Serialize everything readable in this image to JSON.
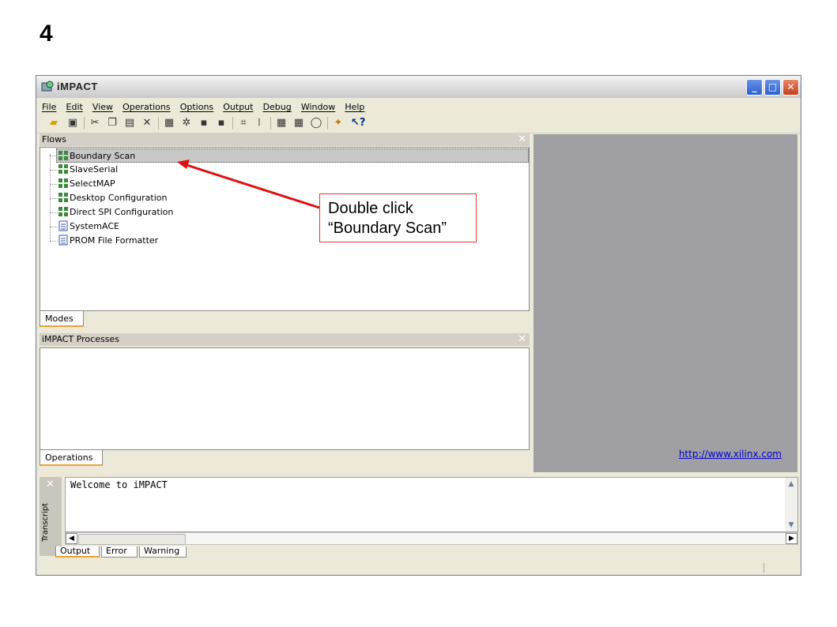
{
  "slide_number": "4",
  "window": {
    "title": "iMPACT"
  },
  "menu": [
    "File",
    "Edit",
    "View",
    "Operations",
    "Options",
    "Output",
    "Debug",
    "Window",
    "Help"
  ],
  "flows_panel": {
    "title": "Flows",
    "items": [
      {
        "label": "Boundary Scan",
        "icon": "chip-grid-icon",
        "selected": true
      },
      {
        "label": "SlaveSerial",
        "icon": "chip-grid-icon"
      },
      {
        "label": "SelectMAP",
        "icon": "chip-grid-icon"
      },
      {
        "label": "Desktop Configuration",
        "icon": "chip-grid-icon"
      },
      {
        "label": "Direct SPI Configuration",
        "icon": "chip-grid-icon"
      },
      {
        "label": "SystemACE",
        "icon": "document-icon"
      },
      {
        "label": "PROM File Formatter",
        "icon": "document-icon"
      }
    ],
    "tab": "Modes"
  },
  "processes_panel": {
    "title": "iMPACT Processes",
    "tab": "Operations"
  },
  "right_panel": {
    "link": "http://www.xilinx.com"
  },
  "transcript": {
    "label": "Transcript",
    "text": "Welcome to iMPACT",
    "tabs": [
      "Output",
      "Error",
      "Warning"
    ]
  },
  "annotation": {
    "line1": "Double click",
    "line2": "“Boundary Scan”"
  },
  "colors": {
    "annotation_border": "#ee3333",
    "arrow": "#e01010",
    "tab_accent": "#e8a33b"
  }
}
